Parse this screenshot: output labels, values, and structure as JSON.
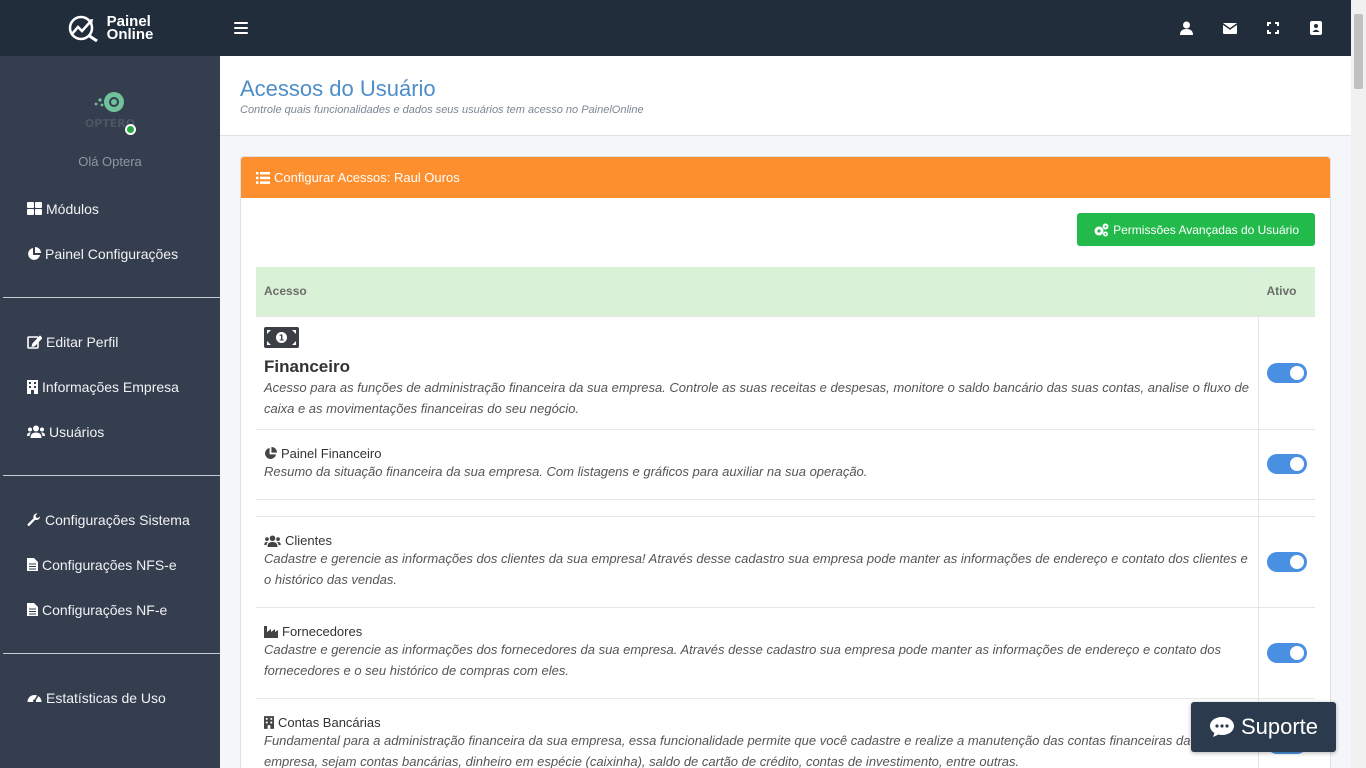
{
  "brand": {
    "line1": "Painel",
    "line2": "Online"
  },
  "topbar": {
    "icons": [
      "menu-icon",
      "user-icon",
      "envelope-icon",
      "expand-icon",
      "address-book-icon"
    ]
  },
  "sidebar": {
    "avatar_text": "OPTERO",
    "greeting": "Olá Optera",
    "items": [
      {
        "label": "Módulos",
        "icon": "grid-icon"
      },
      {
        "label": "Painel Configurações",
        "icon": "pie-chart-icon"
      },
      {
        "label": "Editar Perfil",
        "icon": "edit-icon"
      },
      {
        "label": "Informações Empresa",
        "icon": "building-icon"
      },
      {
        "label": "Usuários",
        "icon": "users-icon"
      },
      {
        "label": "Configurações Sistema",
        "icon": "wrench-icon"
      },
      {
        "label": "Configurações NFS-e",
        "icon": "file-icon"
      },
      {
        "label": "Configurações NF-e",
        "icon": "file-icon"
      },
      {
        "label": "Estatísticas de Uso",
        "icon": "gauge-icon"
      }
    ]
  },
  "page": {
    "title": "Acessos do Usuário",
    "subtitle": "Controle quais funcionalidades e dados seus usuários tem acesso no PainelOnline"
  },
  "card": {
    "header": "Configurar Acessos: Raul Ouros",
    "advanced_button": "Permissões Avançadas do Usuário"
  },
  "table": {
    "headers": {
      "access": "Acesso",
      "active": "Ativo"
    },
    "rows": [
      {
        "title": "Financeiro",
        "description": "Acesso para as funções de administração financeira da sua empresa. Controle as suas receitas e despesas, monitore o saldo bancário das suas contas, analise o fluxo de caixa e as movimentações financeiras do seu negócio.",
        "active": true
      },
      {
        "title": "Painel Financeiro",
        "description": "Resumo da situação financeira da sua empresa. Com listagens e gráficos para auxiliar na sua operação.",
        "active": true
      },
      {
        "title": "Clientes",
        "description": "Cadastre e gerencie as informações dos clientes da sua empresa! Através desse cadastro sua empresa pode manter as informações de endereço e contato dos clientes e o histórico das vendas.",
        "active": true
      },
      {
        "title": "Fornecedores",
        "description": "Cadastre e gerencie as informações dos fornecedores da sua empresa. Através desse cadastro sua empresa pode manter as informações de endereço e contato dos fornecedores e o seu histórico de compras com eles.",
        "active": true
      },
      {
        "title": "Contas Bancárias",
        "description": "Fundamental para a administração financeira da sua empresa, essa funcionalidade permite que você cadastre e realize a manutenção das contas financeiras da sua empresa, sejam contas bancárias, dinheiro em espécie (caixinha), saldo de cartão de crédito, contas de investimento, entre outras.",
        "active": true
      }
    ]
  },
  "support": {
    "label": "Suporte"
  },
  "colors": {
    "topbar": "#222d3c",
    "sidebar": "#343e4e",
    "card_header": "#fd8f2e",
    "button": "#22bb4b",
    "title": "#4e8ec8",
    "toggle": "#4a90e2"
  }
}
